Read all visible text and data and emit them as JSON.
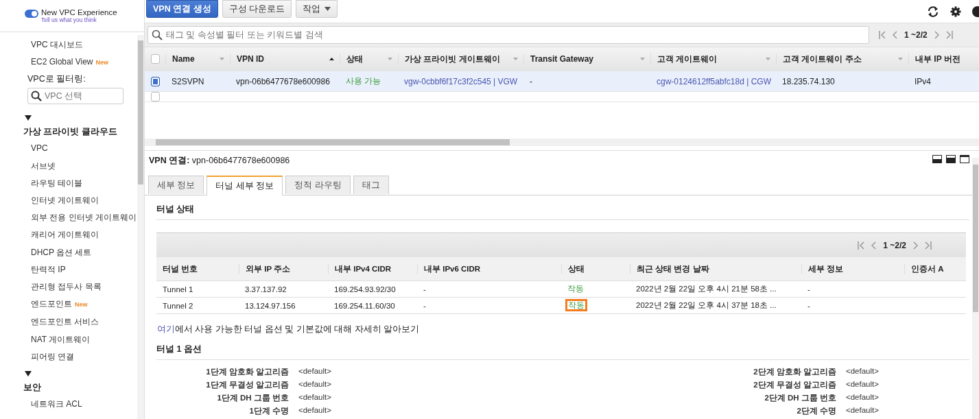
{
  "sidebar": {
    "toggle": {
      "label": "New VPC Experience",
      "on": true,
      "link": "Tell us what you think"
    },
    "top_items": [
      {
        "label": "VPC 대시보드"
      },
      {
        "label": "EC2 Global View",
        "badge": "New"
      }
    ],
    "filter": {
      "label": "VPC로 필터링:",
      "placeholder": "VPC 선택"
    },
    "sections": [
      {
        "title": "가상 프라이빗 클라우드",
        "expanded": true,
        "children": [
          {
            "label": "VPC"
          },
          {
            "label": "서브넷"
          },
          {
            "label": "라우팅 테이블"
          },
          {
            "label": "인터넷 게이트웨이"
          },
          {
            "label": "외부 전용 인터넷 게이트웨이"
          },
          {
            "label": "캐리어 게이트웨이"
          },
          {
            "label": "DHCP 옵션 세트"
          },
          {
            "label": "탄력적 IP"
          },
          {
            "label": "관리형 접두사 목록"
          },
          {
            "label": "엔드포인트",
            "badge": "New"
          },
          {
            "label": "엔드포인트 서비스"
          },
          {
            "label": "NAT 게이트웨이"
          },
          {
            "label": "피어링 연결"
          }
        ]
      },
      {
        "title": "보안",
        "expanded": true,
        "children": [
          {
            "label": "네트워크 ACL"
          }
        ]
      }
    ]
  },
  "toolbar": {
    "buttons": [
      {
        "label": "VPN 연결 생성",
        "kind": "primary"
      },
      {
        "label": "구성 다운로드",
        "kind": "plain"
      },
      {
        "label": "작업",
        "kind": "dropdown"
      }
    ]
  },
  "search": {
    "placeholder": "태그 및 속성별 필터 또는 키워드별 검색"
  },
  "pager": "1 ~2/2",
  "vpn_table": {
    "all_selected": false,
    "columns": [
      {
        "label": "Name",
        "sorted": false
      },
      {
        "label": "VPN ID",
        "sorted": true
      },
      {
        "label": "상태",
        "sorted": false
      },
      {
        "label": "가상 프라이빗 게이트웨이",
        "sorted": false
      },
      {
        "label": "Transit Gateway",
        "sorted": false
      },
      {
        "label": "고객 게이트웨이",
        "sorted": false
      },
      {
        "label": "고객 게이트웨이 주소",
        "sorted": false
      },
      {
        "label": "내부 IP 버전"
      }
    ],
    "rows": [
      {
        "selected": true,
        "cells": [
          "S2SVPN",
          "vpn-06b6477678e600986",
          "사용 가능",
          "vgw-0cbbf6f17c3f2c545 | VGW",
          "-",
          "cgw-0124612ff5abfc18d | CGW",
          "18.235.74.130",
          "IPv4"
        ]
      },
      {
        "selected": false,
        "cells": []
      }
    ]
  },
  "detail": {
    "label": "VPN 연결:",
    "value": "vpn-06b6477678e600986",
    "tabs": [
      {
        "label": "세부 정보",
        "selected": false
      },
      {
        "label": "터널 세부 정보",
        "selected": true
      },
      {
        "label": "정적 라우팅",
        "selected": false
      },
      {
        "label": "태그",
        "selected": false
      }
    ],
    "tunnel_status_title": "터널 상태",
    "pager": "1 ~2/2",
    "tunnel_table": {
      "columns": [
        "터널 번호",
        "외부 IP 주소",
        "내부 IPv4 CIDR",
        "내부 IPv6 CIDR",
        "상태",
        "최근 상태 변경 날짜",
        "세부 정보",
        "인증서 A"
      ],
      "rows": [
        {
          "highlighted": false,
          "cells": [
            "Tunnel 1",
            "3.37.137.92",
            "169.254.93.92/30",
            "-",
            "작동",
            "2022년 2월 22일 오후 4시 21분 58초 ...",
            "-",
            ""
          ]
        },
        {
          "highlighted": true,
          "cells": [
            "Tunnel 2",
            "13.124.97.156",
            "169.254.11.60/30",
            "-",
            "작동",
            "2022년 2월 22일 오후 4시 37분 18초 ...",
            "-",
            ""
          ]
        }
      ]
    },
    "learn_more": {
      "link": "여기",
      "text": "에서 사용 가능한 터널 옵션 및 기본값에 대해 자세히 알아보기"
    },
    "options_title": "터널 1 옵션",
    "options": [
      {
        "label": "1단계 암호화 알고리즘",
        "value": "<default>"
      },
      {
        "label": "2단계 암호화 알고리즘",
        "value": "<default>"
      },
      {
        "label": "1단계 무결성 알고리즘",
        "value": "<default>"
      },
      {
        "label": "2단계 무결성 알고리즘",
        "value": "<default>"
      },
      {
        "label": "1단계 DH 그룹 번호",
        "value": "<default>"
      },
      {
        "label": "2단계 DH 그룹 번호",
        "value": "<default>"
      },
      {
        "label": "1단계 수명",
        "value": "<default>"
      },
      {
        "label": "2단계 수명",
        "value": "<default>"
      }
    ]
  }
}
